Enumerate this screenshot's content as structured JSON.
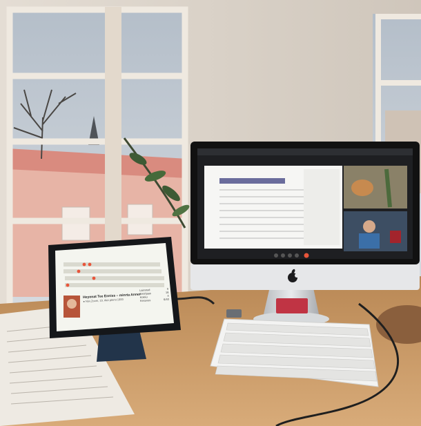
{
  "tablet": {
    "event_title": "Heyonat Tee Enniss – minrta Anners",
    "event_subtitle": "● Nov.Zoom, 19. Alet ptemt 1900",
    "stats": [
      {
        "label": "Laimnud",
        "value": "0"
      },
      {
        "label": "Eesrijaas",
        "value": "16"
      },
      {
        "label": "Kokku",
        "value": "4"
      },
      {
        "label": "Kesuvus",
        "value": "6/40"
      }
    ]
  },
  "colors": {
    "accent": "#e8553a",
    "wall": "#d8cfc4",
    "desk": "#c89a66",
    "building": "#e9b3a8",
    "sky": "#c5ccd4"
  },
  "icons": [
    "apple-logo-icon",
    "video-call-icon"
  ]
}
